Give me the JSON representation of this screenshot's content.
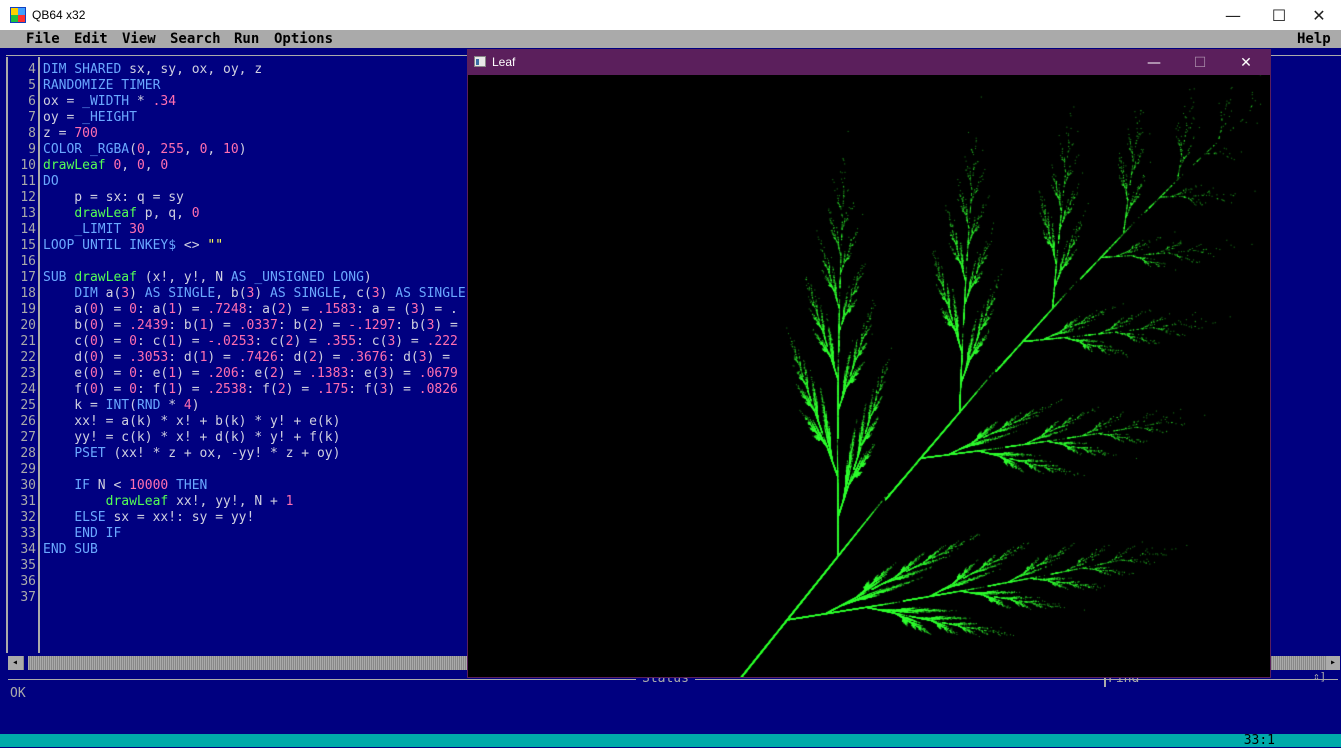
{
  "window": {
    "title": "QB64 x32",
    "minimize": "—",
    "maximize": "☐",
    "close": "✕"
  },
  "menu": {
    "file": "File",
    "edit": "Edit",
    "view": "View",
    "search": "Search",
    "run": "Run",
    "options": "Options",
    "help": "Help"
  },
  "line_numbers": [
    "4",
    "5",
    "6",
    "7",
    "8",
    "9",
    "10",
    "11",
    "12",
    "13",
    "14",
    "15",
    "16",
    "17",
    "18",
    "19",
    "20",
    "21",
    "22",
    "23",
    "24",
    "25",
    "26",
    "27",
    "28",
    "29",
    "30",
    "31",
    "32",
    "33",
    "34",
    "35",
    "36",
    "37"
  ],
  "code": {
    "l4": [
      "DIM SHARED",
      " sx, sy, ox, oy, z"
    ],
    "l5": [
      "RANDOMIZE TIMER"
    ],
    "l6": [
      "ox = ",
      "_WIDTH",
      " * ",
      ".34"
    ],
    "l7": [
      "oy = ",
      "_HEIGHT"
    ],
    "l8": [
      "z = ",
      "700"
    ],
    "l9": [
      "COLOR",
      " ",
      "_RGBA",
      "(",
      "0",
      ", ",
      "255",
      ", ",
      "0",
      ", ",
      "10",
      ")"
    ],
    "l10": [
      "drawLeaf",
      " ",
      "0",
      ", ",
      "0",
      ", ",
      "0"
    ],
    "l11": [
      "DO"
    ],
    "l12": [
      "    p = sx: q = sy"
    ],
    "l13": [
      "    ",
      "drawLeaf",
      " p, q, ",
      "0"
    ],
    "l14": [
      "    ",
      "_LIMIT",
      " ",
      "30"
    ],
    "l15": [
      "LOOP UNTIL INKEY$",
      " <> ",
      "\"\""
    ],
    "l16": [
      ""
    ],
    "l17": [
      "SUB",
      " ",
      "drawLeaf",
      " (x!, y!, N ",
      "AS _UNSIGNED LONG",
      ")"
    ],
    "l18": [
      "    ",
      "DIM",
      " a(",
      "3",
      ") ",
      "AS SINGLE",
      ", b(",
      "3",
      ") ",
      "AS SINGLE",
      ", c(",
      "3",
      ") ",
      "AS SINGLE"
    ],
    "l19": [
      "    a(",
      "0",
      ") = ",
      "0",
      ": a(",
      "1",
      ") = ",
      ".7248",
      ": a(",
      "2",
      ") = ",
      ".1583",
      ": a = (",
      "3",
      ") = ."
    ],
    "l20": [
      "    b(",
      "0",
      ") = ",
      ".2439",
      ": b(",
      "1",
      ") = ",
      ".0337",
      ": b(",
      "2",
      ") = ",
      "-.1297",
      ": b(",
      "3",
      ") ="
    ],
    "l21": [
      "    c(",
      "0",
      ") = ",
      "0",
      ": c(",
      "1",
      ") = ",
      "-.0253",
      ": c(",
      "2",
      ") = ",
      ".355",
      ": c(",
      "3",
      ") = ",
      ".222"
    ],
    "l22": [
      "    d(",
      "0",
      ") = ",
      ".3053",
      ": d(",
      "1",
      ") = ",
      ".7426",
      ": d(",
      "2",
      ") = ",
      ".3676",
      ": d(",
      "3",
      ") ="
    ],
    "l23": [
      "    e(",
      "0",
      ") = ",
      "0",
      ": e(",
      "1",
      ") = ",
      ".206",
      ": e(",
      "2",
      ") = ",
      ".1383",
      ": e(",
      "3",
      ") = ",
      ".0679"
    ],
    "l24": [
      "    f(",
      "0",
      ") = ",
      "0",
      ": f(",
      "1",
      ") = ",
      ".2538",
      ": f(",
      "2",
      ") = ",
      ".175",
      ": f(",
      "3",
      ") = ",
      ".0826"
    ],
    "l25": [
      "    k = ",
      "INT",
      "(",
      "RND",
      " * ",
      "4",
      ")"
    ],
    "l26": [
      "    xx! = a(k) * x! + b(k) * y! + e(k)"
    ],
    "l27": [
      "    yy! = c(k) * x! + d(k) * y! + f(k)"
    ],
    "l28": [
      "    ",
      "PSET",
      " (xx! * z + ox, -yy! * z + oy)"
    ],
    "l29": [
      ""
    ],
    "l30": [
      "    ",
      "IF",
      " N < ",
      "10000",
      " ",
      "THEN"
    ],
    "l31": [
      "        ",
      "drawLeaf",
      " xx!, yy!, N + ",
      "1"
    ],
    "l32": [
      "    ",
      "ELSE",
      " sx = xx!: sy = yy!"
    ],
    "l33": [
      "    ",
      "END IF"
    ],
    "l34": [
      "END SUB"
    ]
  },
  "status": {
    "title": "Status",
    "message": "OK",
    "find_label": "Find",
    "arrows": "⇕]"
  },
  "cursor_position": "33:1",
  "leaf_window": {
    "title": "Leaf",
    "minimize": "—",
    "maximize": "☐",
    "close": "✕"
  },
  "colors": {
    "editor_bg": "#000080",
    "menu_bg": "#aaaaaa",
    "statusbar_bg": "#00aaaa",
    "leaf_titlebar": "#5b1f5c",
    "fern": "#33ff33"
  }
}
